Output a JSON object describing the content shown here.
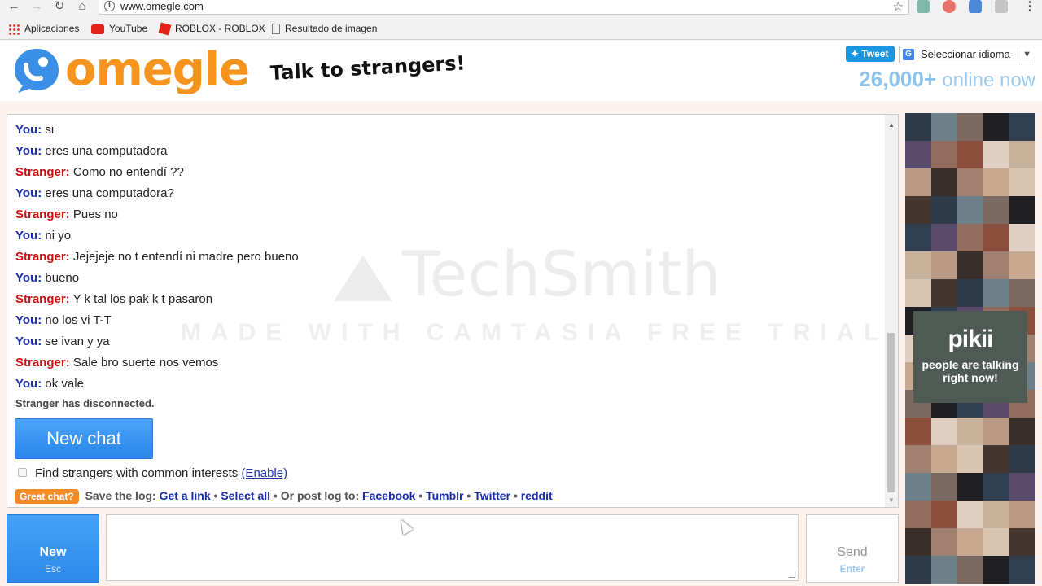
{
  "browser": {
    "url": "www.omegle.com",
    "bookmarks": [
      "Aplicaciones",
      "YouTube",
      "ROBLOX - ROBLOX",
      "Resultado de imagen"
    ]
  },
  "header": {
    "logo_text": "omegle",
    "tagline": "Talk to strangers!",
    "tweet_label": "Tweet",
    "language_label": "Seleccionar idioma",
    "online_count": "26,000+",
    "online_label": "online now"
  },
  "chat": {
    "messages": [
      {
        "who": "You:",
        "text": "si",
        "role": "you"
      },
      {
        "who": "You:",
        "text": "eres una computadora",
        "role": "you"
      },
      {
        "who": "Stranger:",
        "text": "Como no entendí ??",
        "role": "stranger"
      },
      {
        "who": "You:",
        "text": "eres una computadora?",
        "role": "you"
      },
      {
        "who": "Stranger:",
        "text": "Pues no",
        "role": "stranger"
      },
      {
        "who": "You:",
        "text": "ni yo",
        "role": "you"
      },
      {
        "who": "Stranger:",
        "text": "Jejejeje no t entendí ni madre pero bueno",
        "role": "stranger"
      },
      {
        "who": "You:",
        "text": "bueno",
        "role": "you"
      },
      {
        "who": "Stranger:",
        "text": "Y k tal los pak k t pasaron",
        "role": "stranger"
      },
      {
        "who": "You:",
        "text": "no los vi T-T",
        "role": "you"
      },
      {
        "who": "You:",
        "text": "se ivan y ya",
        "role": "you"
      },
      {
        "who": "Stranger:",
        "text": "Sale bro suerte nos vemos",
        "role": "stranger"
      },
      {
        "who": "You:",
        "text": "ok vale",
        "role": "you"
      }
    ],
    "status": "Stranger has disconnected.",
    "new_chat_label": "New chat",
    "interests_label": "Find strangers with common interests",
    "enable_label": "(Enable)",
    "great_chat_label": "Great chat?",
    "save_log_label": "Save the log:",
    "get_link_label": "Get a link",
    "select_all_label": "Select all",
    "post_log_label": "Or post log to:",
    "facebook_label": "Facebook",
    "tumblr_label": "Tumblr",
    "twitter_label": "Twitter",
    "reddit_label": "reddit"
  },
  "bottom": {
    "new_label": "New",
    "new_key": "Esc",
    "send_label": "Send",
    "send_key": "Enter"
  },
  "ad": {
    "brand": "pikii",
    "slogan": "people are talking right now!"
  },
  "watermark": {
    "line1": "TechSmith",
    "line2": "MADE WITH CAMTASIA FREE TRIAL"
  }
}
